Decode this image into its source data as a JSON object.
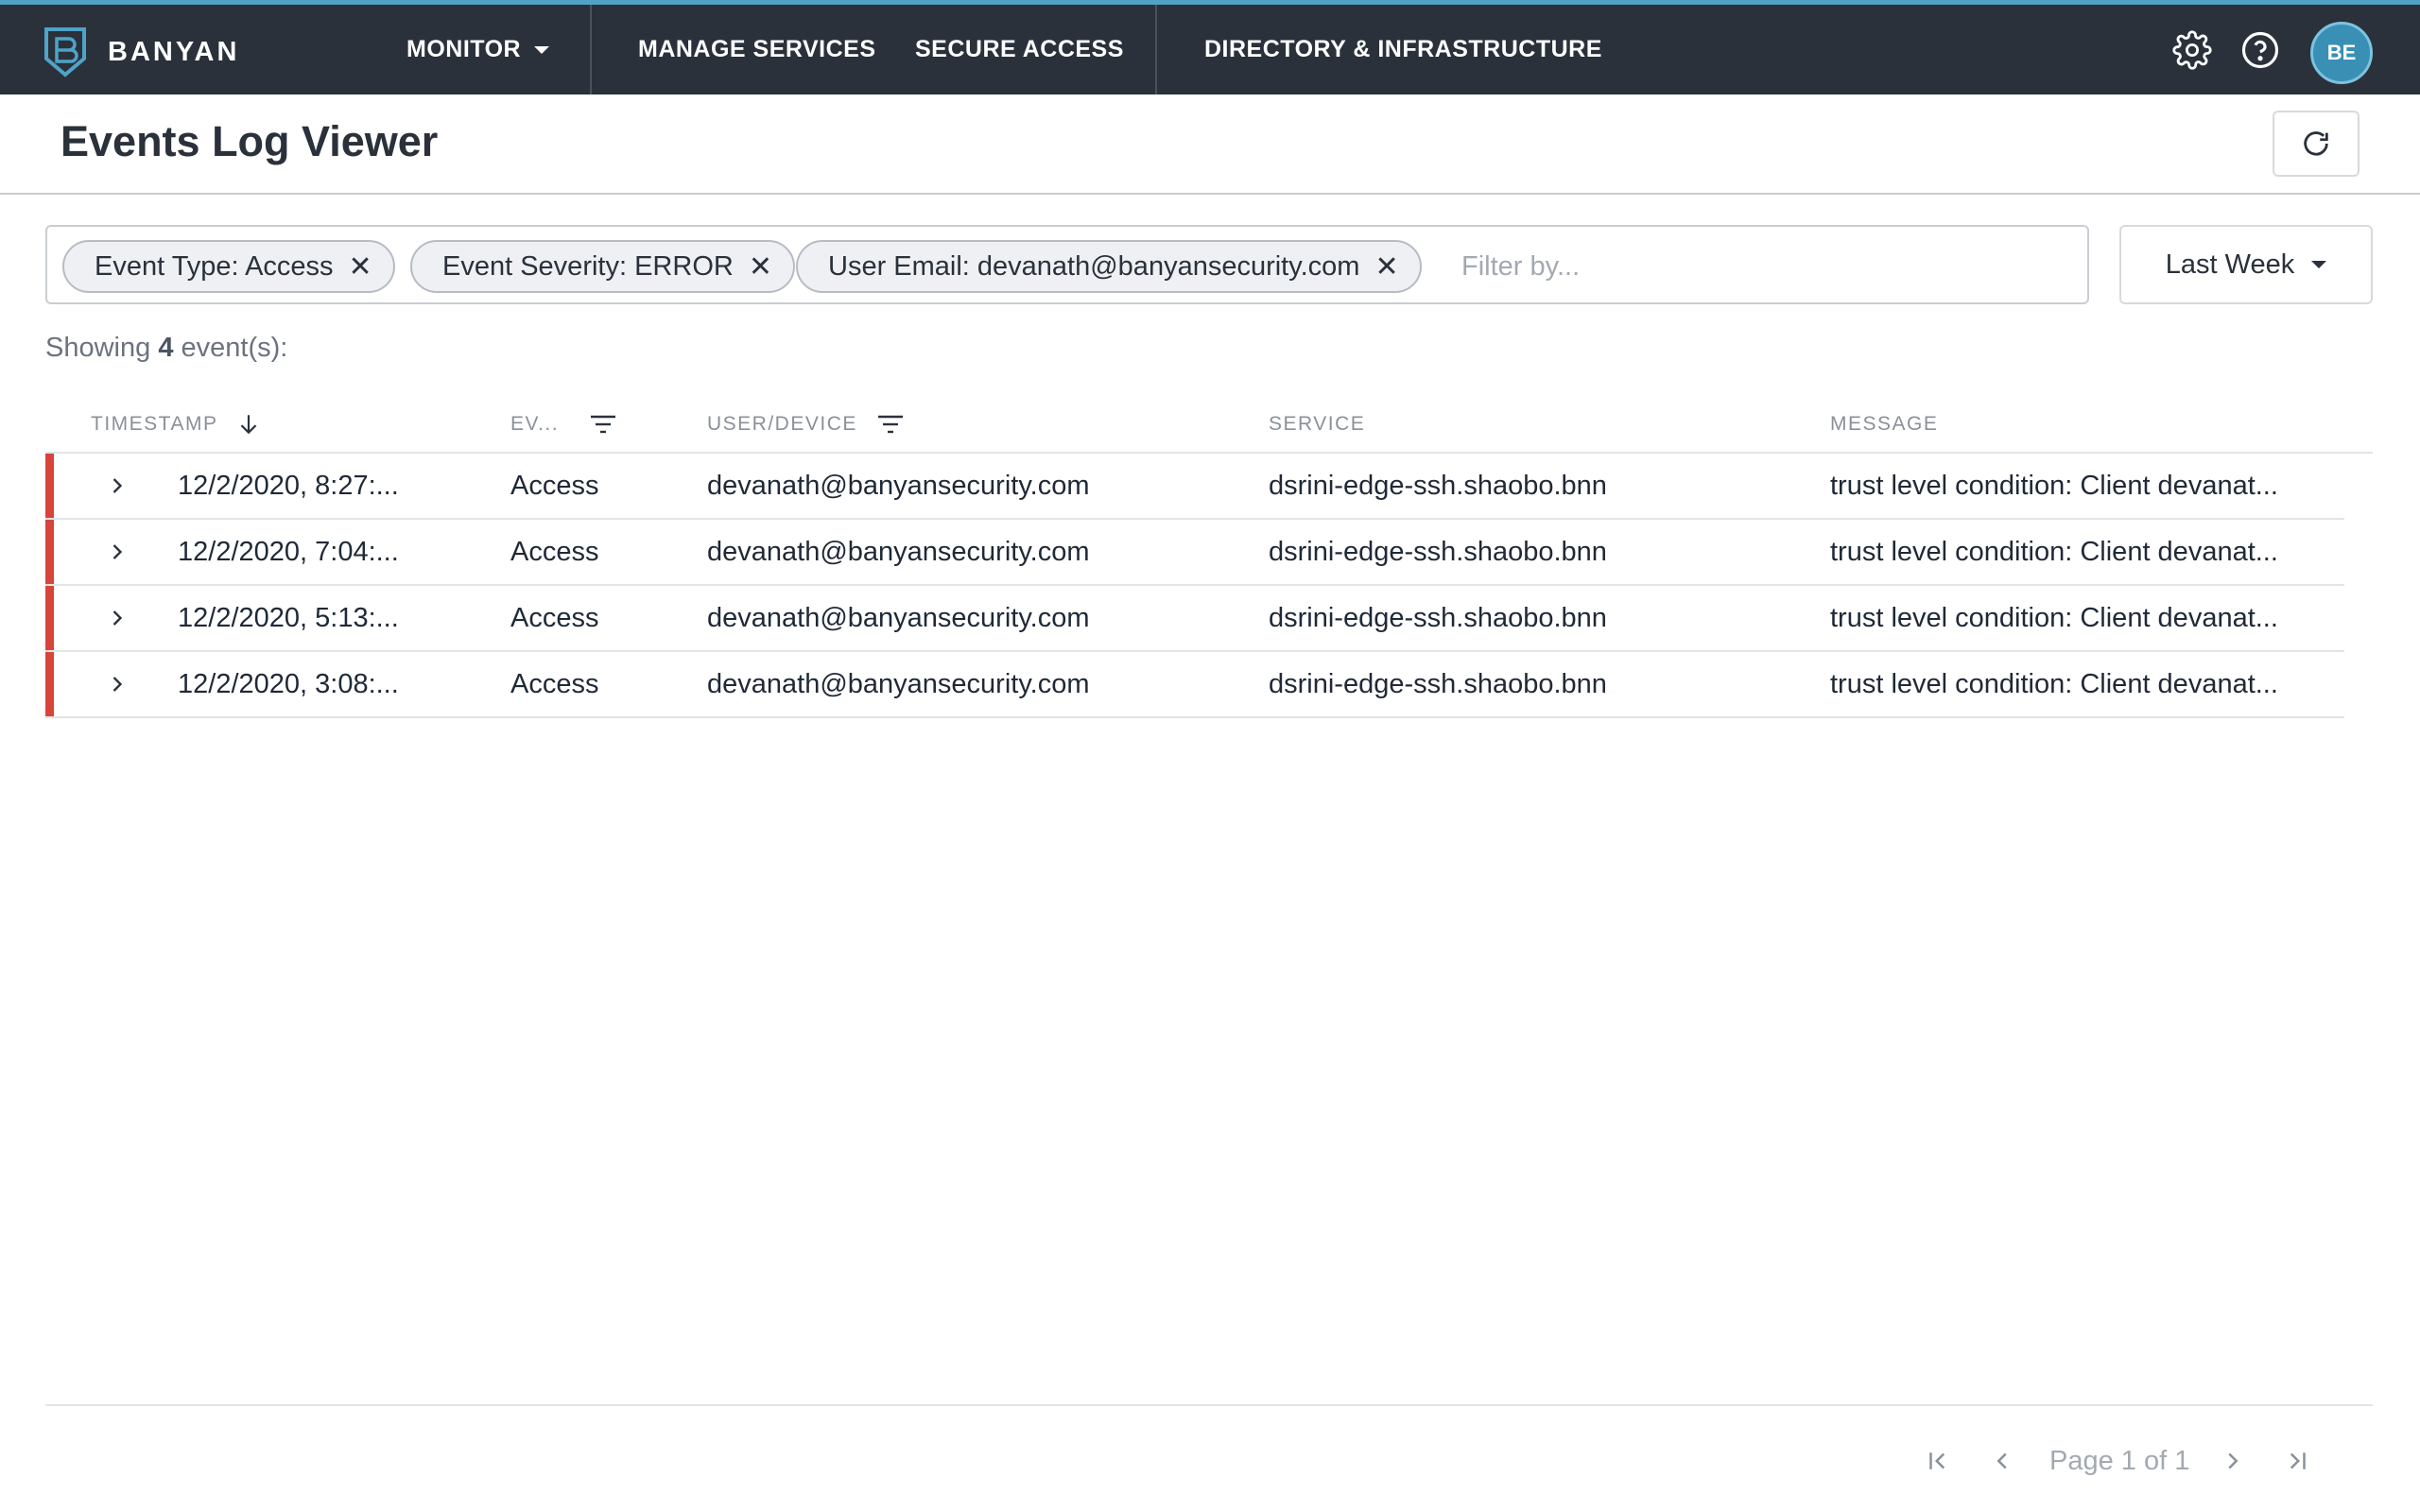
{
  "nav": {
    "brand": "BANYAN",
    "items": [
      {
        "label": "MONITOR",
        "has_dropdown": true
      },
      {
        "label": "MANAGE SERVICES"
      },
      {
        "label": "SECURE ACCESS"
      },
      {
        "label": "DIRECTORY & INFRASTRUCTURE"
      }
    ],
    "icons": [
      "gear-icon",
      "help-circle-icon"
    ],
    "avatar_initials": "BE",
    "accent_color": "#4fa3c7",
    "bar_color": "#2a313b"
  },
  "header": {
    "title": "Events Log Viewer",
    "refresh_icon": "refresh-icon"
  },
  "filters": {
    "chips": [
      {
        "label": "Event Type: Access"
      },
      {
        "label": "Event Severity: ERROR"
      },
      {
        "label": "User Email: devanath@banyansecurity.com"
      }
    ],
    "placeholder": "Filter by...",
    "range": "Last Week"
  },
  "summary": {
    "prefix": "Showing ",
    "count": "4",
    "suffix": " event(s):"
  },
  "table": {
    "columns": [
      {
        "label": "TIMESTAMP",
        "icon": "arrow-down-icon"
      },
      {
        "label": "EV...",
        "icon": "filter-icon"
      },
      {
        "label": "USER/DEVICE",
        "icon": "filter-icon"
      },
      {
        "label": "SERVICE"
      },
      {
        "label": "MESSAGE"
      }
    ],
    "severity_color": "#d9443a",
    "rows": [
      {
        "timestamp": "12/2/2020, 8:27:...",
        "event": "Access",
        "user": "devanath@banyansecurity.com",
        "service": "dsrini-edge-ssh.shaobo.bnn",
        "message": "trust level condition: Client devanat..."
      },
      {
        "timestamp": "12/2/2020, 7:04:...",
        "event": "Access",
        "user": "devanath@banyansecurity.com",
        "service": "dsrini-edge-ssh.shaobo.bnn",
        "message": "trust level condition: Client devanat..."
      },
      {
        "timestamp": "12/2/2020, 5:13:...",
        "event": "Access",
        "user": "devanath@banyansecurity.com",
        "service": "dsrini-edge-ssh.shaobo.bnn",
        "message": "trust level condition: Client devanat..."
      },
      {
        "timestamp": "12/2/2020, 3:08:...",
        "event": "Access",
        "user": "devanath@banyansecurity.com",
        "service": "dsrini-edge-ssh.shaobo.bnn",
        "message": "trust level condition: Client devanat..."
      }
    ]
  },
  "pagination": {
    "label": "Page 1 of 1",
    "icons": [
      "first-page-icon",
      "prev-page-icon",
      "next-page-icon",
      "last-page-icon"
    ]
  }
}
